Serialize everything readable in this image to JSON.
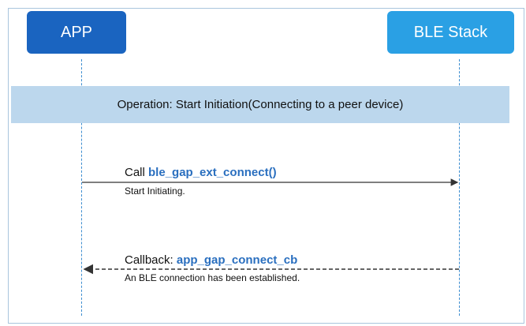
{
  "participants": {
    "app": "APP",
    "ble_stack": "BLE Stack"
  },
  "operation": {
    "label": "Operation: Start Initiation(Connecting to a peer device)"
  },
  "messages": [
    {
      "prefix": "Call",
      "api": "ble_gap_ext_connect()",
      "description": "Start Initiating.",
      "direction": "APP -> BLE Stack",
      "style": "solid"
    },
    {
      "prefix": "Callback:",
      "api": "app_gap_connect_cb",
      "description": "An BLE connection has been established.",
      "direction": "BLE Stack -> APP",
      "style": "dashed"
    }
  ],
  "colors": {
    "app_box": "#1a64c0",
    "ble_box": "#2aa0e4",
    "operation_band": "#bcd7ed",
    "api_text": "#2a6fbf",
    "lifeline": "#3e8ed0"
  }
}
